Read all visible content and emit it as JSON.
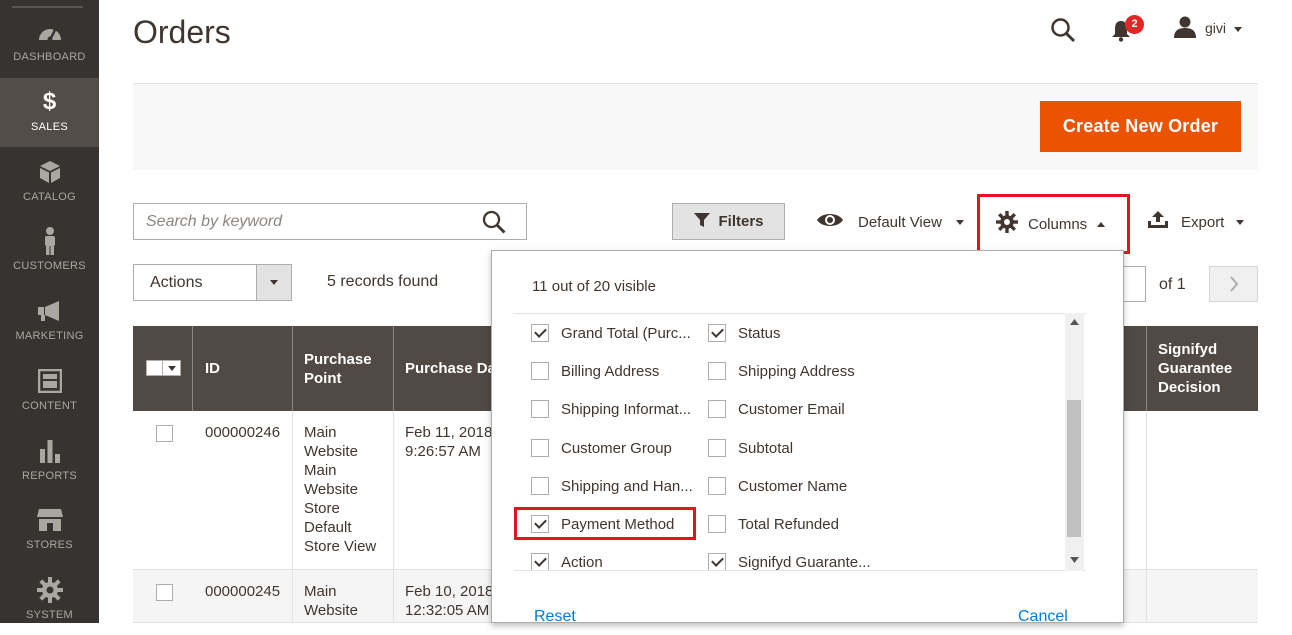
{
  "sidebar": {
    "items": [
      {
        "label": "DASHBOARD",
        "icon": "dashboard-icon"
      },
      {
        "label": "SALES",
        "icon": "dollar-icon"
      },
      {
        "label": "CATALOG",
        "icon": "box-icon"
      },
      {
        "label": "CUSTOMERS",
        "icon": "person-icon"
      },
      {
        "label": "MARKETING",
        "icon": "megaphone-icon"
      },
      {
        "label": "CONTENT",
        "icon": "layout-icon"
      },
      {
        "label": "REPORTS",
        "icon": "bar-chart-icon"
      },
      {
        "label": "STORES",
        "icon": "store-icon"
      },
      {
        "label": "SYSTEM",
        "icon": "gear-icon"
      }
    ]
  },
  "header": {
    "title": "Orders",
    "notification_count": "2",
    "user_name": "givi"
  },
  "actions": {
    "create_label": "Create New Order"
  },
  "toolbar": {
    "search_placeholder": "Search by keyword",
    "filters_label": "Filters",
    "view_label": "Default View",
    "columns_label": "Columns",
    "export_label": "Export",
    "mass_actions_label": "Actions",
    "records_found": "5 records found",
    "page_of": "of 1"
  },
  "table": {
    "headers": [
      "ID",
      "Purchase Point",
      "Purchase Date",
      "Signifyd Guarantee Decision"
    ],
    "rows": [
      {
        "id": "000000246",
        "purchase_point": "Main Website Main Website Store Default Store View",
        "date": "Feb 11, 2018 9:26:57 AM"
      },
      {
        "id": "000000245",
        "purchase_point": "Main Website",
        "date": "Feb 10, 2018 12:32:05 AM"
      }
    ]
  },
  "columns_panel": {
    "visible_count": "11 out of 20 visible",
    "options": [
      {
        "label": "Grand Total (Purc...",
        "checked": true
      },
      {
        "label": "Status",
        "checked": true
      },
      {
        "label": "Billing Address",
        "checked": false
      },
      {
        "label": "Shipping Address",
        "checked": false
      },
      {
        "label": "Shipping Informat...",
        "checked": false
      },
      {
        "label": "Customer Email",
        "checked": false
      },
      {
        "label": "Customer Group",
        "checked": false
      },
      {
        "label": "Subtotal",
        "checked": false
      },
      {
        "label": "Shipping and Han...",
        "checked": false
      },
      {
        "label": "Customer Name",
        "checked": false
      },
      {
        "label": "Payment Method",
        "checked": true
      },
      {
        "label": "Total Refunded",
        "checked": false
      },
      {
        "label": "Action",
        "checked": true
      },
      {
        "label": "Signifyd Guarante...",
        "checked": true
      }
    ],
    "reset_label": "Reset",
    "cancel_label": "Cancel"
  },
  "colors": {
    "accent": "#eb5202",
    "sidebar_bg": "#373330",
    "table_header_bg": "#514943",
    "highlight": "#e0161e",
    "link": "#007bdb"
  }
}
